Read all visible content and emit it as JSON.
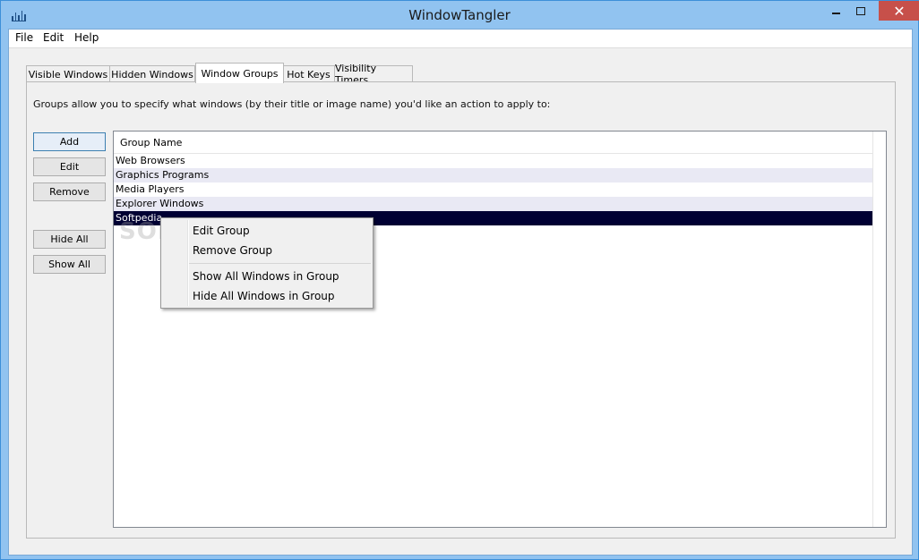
{
  "window": {
    "title": "WindowTangler",
    "controls": {
      "minimize": "minimize",
      "maximize": "maximize",
      "close": "✕"
    }
  },
  "menubar": {
    "items": [
      "File",
      "Edit",
      "Help"
    ]
  },
  "tabs": [
    {
      "label": "Visible Windows",
      "active": false
    },
    {
      "label": "Hidden Windows",
      "active": false
    },
    {
      "label": "Window Groups",
      "active": true
    },
    {
      "label": "Hot Keys",
      "active": false
    },
    {
      "label": "Visibility Timers",
      "active": false
    }
  ],
  "panel": {
    "description": "Groups allow you to specify what windows (by their title or image name) you'd like an action to apply to:",
    "buttons": {
      "add": "Add",
      "edit": "Edit",
      "remove": "Remove",
      "hide_all": "Hide All",
      "show_all": "Show All"
    }
  },
  "list": {
    "column_header": "Group Name",
    "rows": [
      "Web Browsers",
      "Graphics Programs",
      "Media Players",
      "Explorer Windows",
      "Softpedia"
    ],
    "selected_index": 4
  },
  "watermark": "SOFTPEDIA",
  "context_menu": {
    "items": [
      "Edit Group",
      "Remove Group",
      "Show All Windows in Group",
      "Hide All Windows in Group"
    ]
  },
  "colors": {
    "titlebar": "#91c3f0",
    "close_button": "#c7504a",
    "selection": "#000033",
    "alt_row": "#e9e9f4"
  },
  "icons": {
    "app": "bar-chart-icon"
  }
}
